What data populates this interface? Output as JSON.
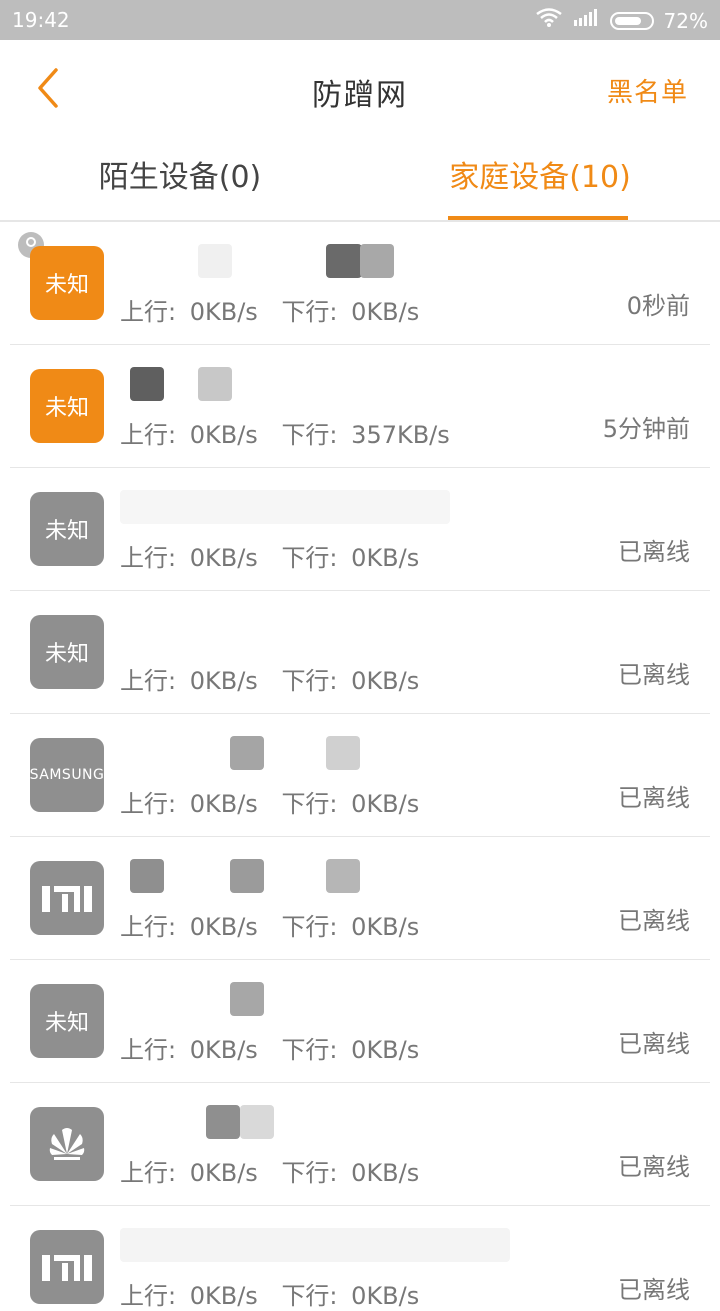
{
  "statusbar": {
    "time": "19:42",
    "battery": "72%"
  },
  "header": {
    "title": "防蹭网",
    "blacklist": "黑名单"
  },
  "tabs": [
    {
      "label": "陌生设备(0)"
    },
    {
      "label": "家庭设备(10)"
    }
  ],
  "labels": {
    "up": "上行:",
    "down": "下行:"
  },
  "devices": [
    {
      "icon": "未知",
      "up": "0KB/s",
      "down": "0KB/s",
      "time": "0秒前",
      "color": "#f08a16"
    },
    {
      "icon": "未知",
      "up": "0KB/s",
      "down": "357KB/s",
      "time": "5分钟前",
      "color": "#f08a16"
    },
    {
      "icon": "未知",
      "up": "0KB/s",
      "down": "0KB/s",
      "time": "已离线",
      "color": "#8f8f8f"
    },
    {
      "icon": "未知",
      "up": "0KB/s",
      "down": "0KB/s",
      "time": "已离线",
      "color": "#8f8f8f"
    },
    {
      "icon": "SAMSUNG",
      "up": "0KB/s",
      "down": "0KB/s",
      "time": "已离线",
      "color": "#8f8f8f"
    },
    {
      "icon": "mi",
      "up": "0KB/s",
      "down": "0KB/s",
      "time": "已离线",
      "color": "#8f8f8f"
    },
    {
      "icon": "未知",
      "up": "0KB/s",
      "down": "0KB/s",
      "time": "已离线",
      "color": "#8f8f8f"
    },
    {
      "icon": "huawei",
      "up": "0KB/s",
      "down": "0KB/s",
      "time": "已离线",
      "color": "#8f8f8f"
    },
    {
      "icon": "mi",
      "up": "0KB/s",
      "down": "0KB/s",
      "time": "已离线",
      "color": "#8f8f8f"
    }
  ]
}
